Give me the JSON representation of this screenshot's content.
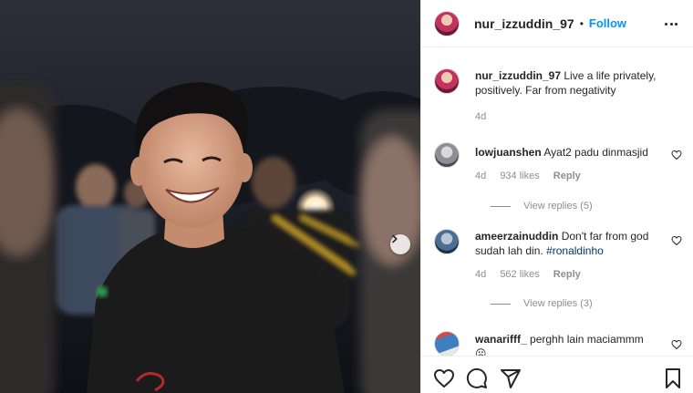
{
  "post": {
    "username": "nur_izzuddin_97",
    "separator": "•",
    "follow_label": "Follow"
  },
  "caption": {
    "username": "nur_izzuddin_97",
    "text": "Live a life privately, positively. Far from negativity",
    "time": "4d"
  },
  "comments": [
    {
      "username": "lowjuanshen",
      "text": "Ayat2 padu dinmasjid",
      "time": "4d",
      "likes": "934 likes",
      "reply": "Reply",
      "view_replies": "View replies (5)"
    },
    {
      "username": "ameerzainuddin",
      "text": "Don't far from god sudah lah din.",
      "hashtag": "#ronaldinho",
      "time": "4d",
      "likes": "562 likes",
      "reply": "Reply",
      "view_replies": "View replies (3)"
    },
    {
      "username": "wanarifff_",
      "text": "perghh lain maciammm",
      "emoji": "☹"
    }
  ],
  "icons": {
    "more": "more-icon",
    "carousel_next": "chevron-right-icon",
    "like": "heart-icon",
    "comment": "comment-icon",
    "share": "share-icon",
    "save": "bookmark-icon"
  },
  "colors": {
    "link": "#0095f6",
    "text": "#262626",
    "muted": "#8e8e8e",
    "hashtag": "#00376b"
  }
}
